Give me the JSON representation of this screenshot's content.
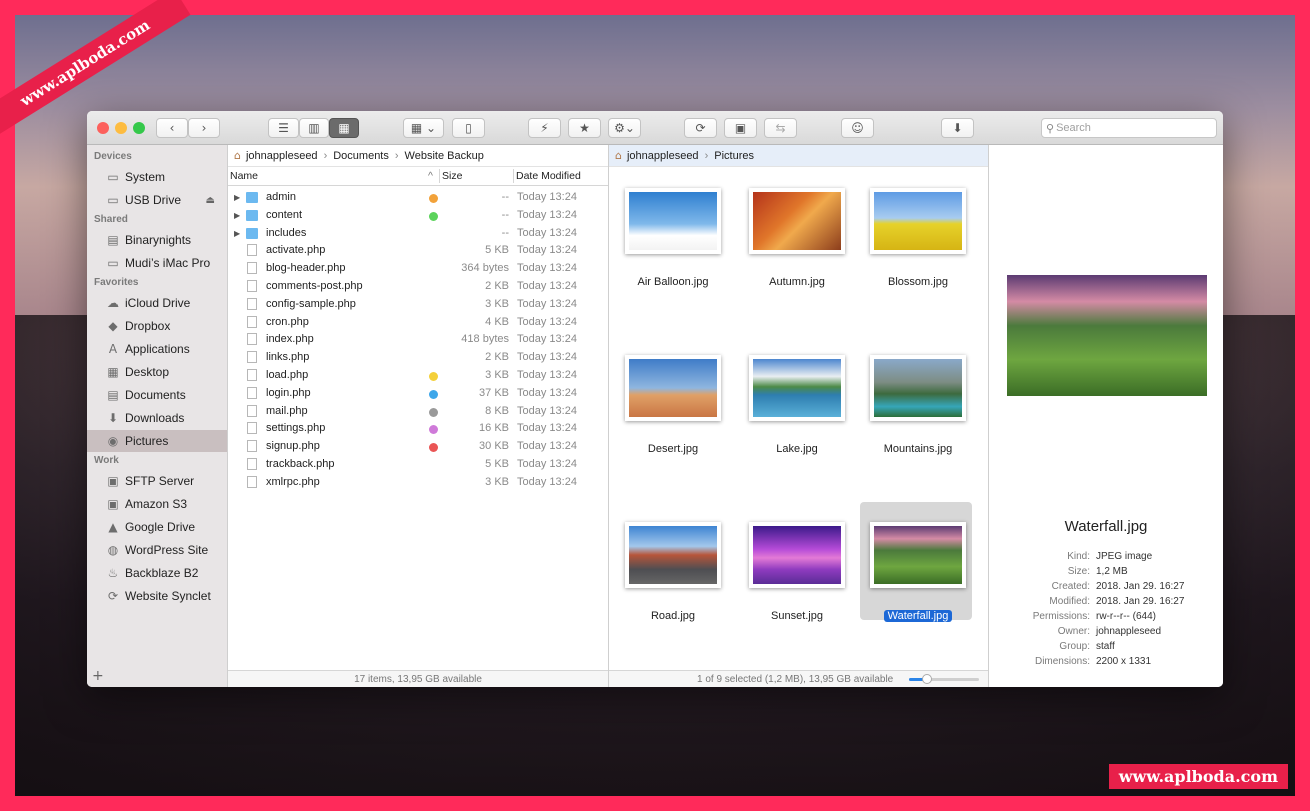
{
  "watermark": {
    "corner": "www.aplboda.com",
    "bottom": "www.aplboda.com"
  },
  "toolbar": {
    "back": "‹",
    "forward": "›",
    "view_list": "☰",
    "view_columns": "▥",
    "view_icons": "▦",
    "arrange": "▦ ⌄",
    "new_file": "▯",
    "quick_action": "⚡",
    "favorite": "★",
    "gear": "⚙⌄",
    "sync": "⟳",
    "terminal": "▣",
    "compare": "⇆",
    "emoji": "☺",
    "download": "⬇",
    "search_placeholder": "Search"
  },
  "sidebar": {
    "sections": [
      {
        "title": "Devices",
        "items": [
          {
            "label": "System",
            "icon": "disk-icon"
          },
          {
            "label": "USB Drive",
            "icon": "usb-drive-icon",
            "eject": "⏏"
          }
        ]
      },
      {
        "title": "Shared",
        "items": [
          {
            "label": "Binarynights",
            "icon": "server-icon"
          },
          {
            "label": "Mudi’s iMac Pro",
            "icon": "imac-icon"
          }
        ]
      },
      {
        "title": "Favorites",
        "items": [
          {
            "label": "iCloud Drive",
            "icon": "cloud-icon"
          },
          {
            "label": "Dropbox",
            "icon": "dropbox-icon"
          },
          {
            "label": "Applications",
            "icon": "applications-icon"
          },
          {
            "label": "Desktop",
            "icon": "desktop-icon"
          },
          {
            "label": "Documents",
            "icon": "documents-icon"
          },
          {
            "label": "Downloads",
            "icon": "downloads-icon"
          },
          {
            "label": "Pictures",
            "icon": "camera-icon",
            "selected": true
          }
        ]
      },
      {
        "title": "Work",
        "items": [
          {
            "label": "SFTP Server",
            "icon": "lock-icon"
          },
          {
            "label": "Amazon S3",
            "icon": "lock-icon"
          },
          {
            "label": "Google Drive",
            "icon": "google-drive-icon"
          },
          {
            "label": "WordPress Site",
            "icon": "wordpress-icon"
          },
          {
            "label": "Backblaze B2",
            "icon": "backblaze-icon"
          },
          {
            "label": "Website Synclet",
            "icon": "sync-icon"
          }
        ]
      }
    ],
    "add": "+"
  },
  "left_pane": {
    "breadcrumb": [
      "johnappleseed",
      "Documents",
      "Website Backup"
    ],
    "columns": {
      "name": "Name",
      "size": "Size",
      "date": "Date Modified",
      "sort": "^"
    },
    "files": [
      {
        "name": "admin",
        "folder": true,
        "tag": "#f2a23a",
        "size": "--",
        "date": "Today 13:24"
      },
      {
        "name": "content",
        "folder": true,
        "tag": "#5bd35b",
        "size": "--",
        "date": "Today 13:24"
      },
      {
        "name": "includes",
        "folder": true,
        "tag": "",
        "size": "--",
        "date": "Today 13:24"
      },
      {
        "name": "activate.php",
        "folder": false,
        "tag": "",
        "size": "5 KB",
        "date": "Today 13:24"
      },
      {
        "name": "blog-header.php",
        "folder": false,
        "tag": "",
        "size": "364 bytes",
        "date": "Today 13:24"
      },
      {
        "name": "comments-post.php",
        "folder": false,
        "tag": "",
        "size": "2 KB",
        "date": "Today 13:24"
      },
      {
        "name": "config-sample.php",
        "folder": false,
        "tag": "",
        "size": "3 KB",
        "date": "Today 13:24"
      },
      {
        "name": "cron.php",
        "folder": false,
        "tag": "",
        "size": "4 KB",
        "date": "Today 13:24"
      },
      {
        "name": "index.php",
        "folder": false,
        "tag": "",
        "size": "418 bytes",
        "date": "Today 13:24"
      },
      {
        "name": "links.php",
        "folder": false,
        "tag": "",
        "size": "2 KB",
        "date": "Today 13:24"
      },
      {
        "name": "load.php",
        "folder": false,
        "tag": "#f4d03a",
        "size": "3 KB",
        "date": "Today 13:24"
      },
      {
        "name": "login.php",
        "folder": false,
        "tag": "#3ea7ea",
        "size": "37 KB",
        "date": "Today 13:24"
      },
      {
        "name": "mail.php",
        "folder": false,
        "tag": "#9a9a9a",
        "size": "8 KB",
        "date": "Today 13:24"
      },
      {
        "name": "settings.php",
        "folder": false,
        "tag": "#cf7ad9",
        "size": "16 KB",
        "date": "Today 13:24"
      },
      {
        "name": "signup.php",
        "folder": false,
        "tag": "#ea5555",
        "size": "30 KB",
        "date": "Today 13:24"
      },
      {
        "name": "trackback.php",
        "folder": false,
        "tag": "",
        "size": "5 KB",
        "date": "Today 13:24"
      },
      {
        "name": "xmlrpc.php",
        "folder": false,
        "tag": "",
        "size": "3 KB",
        "date": "Today 13:24"
      }
    ],
    "status": "17 items, 13,95 GB available"
  },
  "right_pane": {
    "breadcrumb": [
      "johnappleseed",
      "Pictures"
    ],
    "images": [
      {
        "name": "Air Balloon.jpg",
        "style": "p-balloon"
      },
      {
        "name": "Autumn.jpg",
        "style": "p-autumn"
      },
      {
        "name": "Blossom.jpg",
        "style": "p-blossom"
      },
      {
        "name": "Desert.jpg",
        "style": "p-desert"
      },
      {
        "name": "Lake.jpg",
        "style": "p-lake"
      },
      {
        "name": "Mountains.jpg",
        "style": "p-mountains"
      },
      {
        "name": "Road.jpg",
        "style": "p-road"
      },
      {
        "name": "Sunset.jpg",
        "style": "p-sunset"
      },
      {
        "name": "Waterfall.jpg",
        "style": "p-waterfall",
        "selected": true
      }
    ],
    "status": "1 of 9 selected (1,2 MB), 13,95 GB available",
    "zoom_level": 0.25
  },
  "preview": {
    "title": "Waterfall.jpg",
    "info": [
      {
        "k": "Kind:",
        "v": "JPEG image"
      },
      {
        "k": "Size:",
        "v": "1,2 MB"
      },
      {
        "k": "Created:",
        "v": "2018. Jan 29. 16:27"
      },
      {
        "k": "Modified:",
        "v": "2018. Jan 29. 16:27"
      },
      {
        "k": "Permissions:",
        "v": "rw-r--r-- (644)"
      },
      {
        "k": "Owner:",
        "v": "johnappleseed"
      },
      {
        "k": "Group:",
        "v": "staff"
      },
      {
        "k": "Dimensions:",
        "v": "2200 x 1331"
      }
    ]
  }
}
